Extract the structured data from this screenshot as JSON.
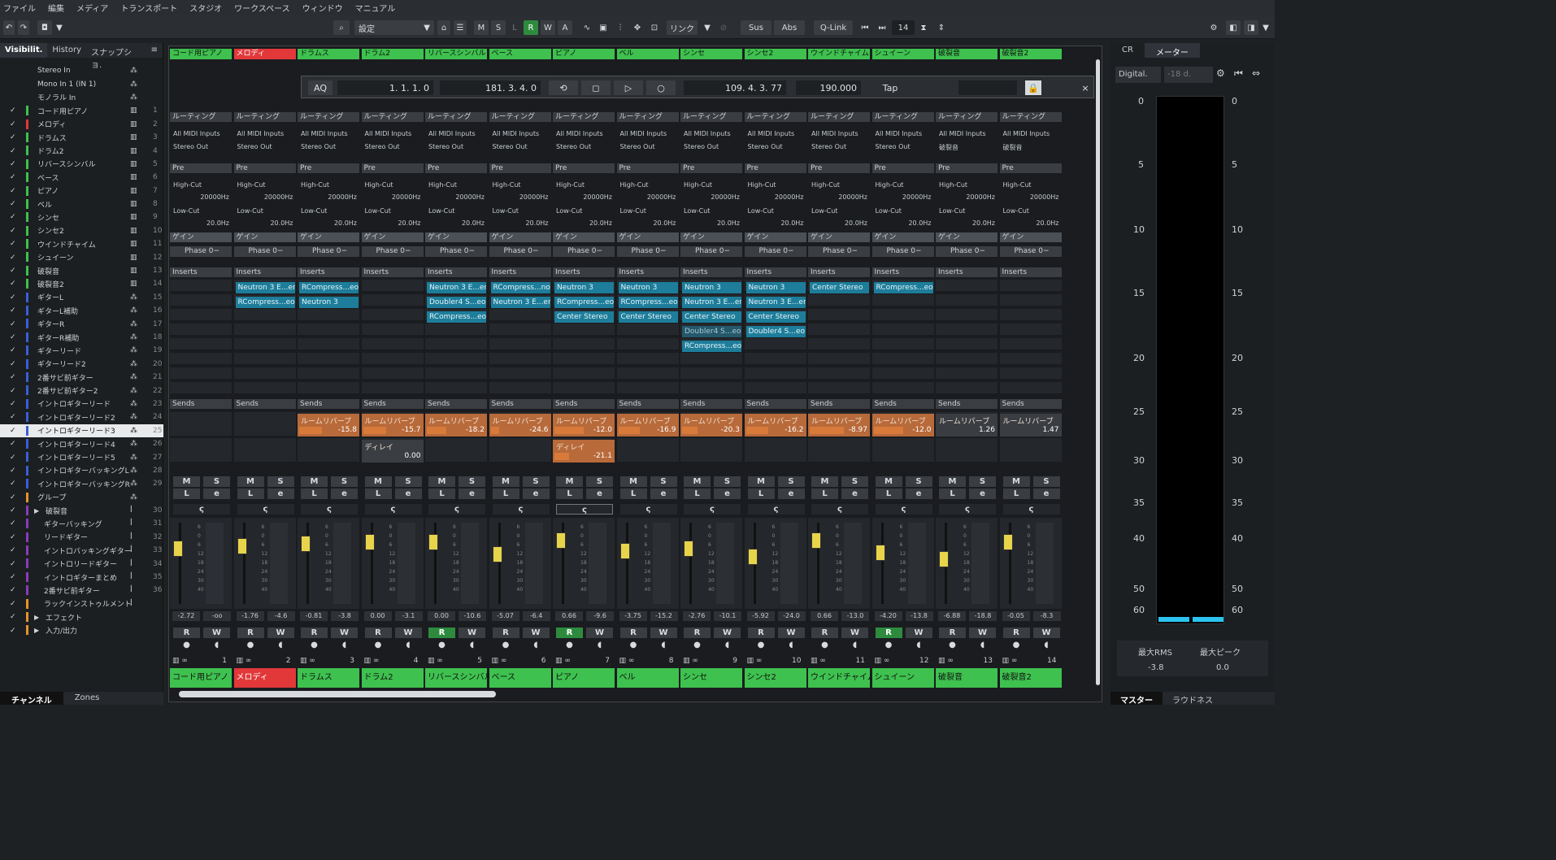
{
  "menu": [
    "ファイル",
    "編集",
    "メディア",
    "トランスポート",
    "スタジオ",
    "ワークスペース",
    "ウィンドウ",
    "マニュアル"
  ],
  "toolbar": {
    "preset": "設定",
    "buttons": [
      "M",
      "S",
      "L",
      "R",
      "W",
      "A"
    ],
    "link": "リンク",
    "sus": "Sus",
    "abs": "Abs",
    "qlink": "Q-Link",
    "count": "14"
  },
  "transport": {
    "aq": "AQ",
    "left_locator": "1. 1. 1.   0",
    "right_locator": "181. 3. 4.   0",
    "position": "109. 4. 3.  77",
    "tempo": "190.000",
    "tap": "Tap"
  },
  "left_panel": {
    "tabs": [
      "Visibilit.",
      "History",
      "スナップショ."
    ],
    "bottom_tabs": [
      "チャンネル",
      "Zones"
    ],
    "rows": [
      {
        "chk": "",
        "color": "",
        "name": "Stereo In",
        "num": ""
      },
      {
        "chk": "",
        "color": "",
        "name": "Mono In 1 (IN 1)",
        "num": ""
      },
      {
        "chk": "",
        "color": "",
        "name": "モノラル In",
        "num": ""
      },
      {
        "chk": "✓",
        "color": "#3ec14f",
        "name": "コード用ピアノ",
        "num": "1"
      },
      {
        "chk": "✓",
        "color": "#e2383a",
        "name": "メロディ",
        "num": "2"
      },
      {
        "chk": "✓",
        "color": "#3ec14f",
        "name": "ドラムス",
        "num": "3"
      },
      {
        "chk": "✓",
        "color": "#3ec14f",
        "name": "ドラム2",
        "num": "4"
      },
      {
        "chk": "✓",
        "color": "#3ec14f",
        "name": "リバースシンバル",
        "num": "5"
      },
      {
        "chk": "✓",
        "color": "#3ec14f",
        "name": "ベース",
        "num": "6"
      },
      {
        "chk": "✓",
        "color": "#3ec14f",
        "name": "ピアノ",
        "num": "7"
      },
      {
        "chk": "✓",
        "color": "#3ec14f",
        "name": "ベル",
        "num": "8"
      },
      {
        "chk": "✓",
        "color": "#3ec14f",
        "name": "シンセ",
        "num": "9"
      },
      {
        "chk": "✓",
        "color": "#3ec14f",
        "name": "シンセ2",
        "num": "10"
      },
      {
        "chk": "✓",
        "color": "#3ec14f",
        "name": "ウインドチャイム",
        "num": "11"
      },
      {
        "chk": "✓",
        "color": "#3ec14f",
        "name": "シュイーン",
        "num": "12"
      },
      {
        "chk": "✓",
        "color": "#3ec14f",
        "name": "破裂音",
        "num": "13"
      },
      {
        "chk": "✓",
        "color": "#3ec14f",
        "name": "破裂音2",
        "num": "14"
      },
      {
        "chk": "✓",
        "color": "#3a5ed8",
        "name": "ギターL",
        "num": "15"
      },
      {
        "chk": "✓",
        "color": "#3a5ed8",
        "name": "ギターL補助",
        "num": "16"
      },
      {
        "chk": "✓",
        "color": "#3a5ed8",
        "name": "ギターR",
        "num": "17"
      },
      {
        "chk": "✓",
        "color": "#3a5ed8",
        "name": "ギターR補助",
        "num": "18"
      },
      {
        "chk": "✓",
        "color": "#3a5ed8",
        "name": "ギターリード",
        "num": "19"
      },
      {
        "chk": "✓",
        "color": "#3a5ed8",
        "name": "ギターリード2",
        "num": "20"
      },
      {
        "chk": "✓",
        "color": "#3a5ed8",
        "name": "2番サビ前ギター",
        "num": "21"
      },
      {
        "chk": "✓",
        "color": "#3a5ed8",
        "name": "2番サビ前ギター2",
        "num": "22"
      },
      {
        "chk": "✓",
        "color": "#3a5ed8",
        "name": "イントロギターリード",
        "num": "23"
      },
      {
        "chk": "✓",
        "color": "#3a5ed8",
        "name": "イントロギターリード2",
        "num": "24"
      },
      {
        "chk": "✓",
        "color": "#3a5ed8",
        "name": "イントロギターリード3",
        "num": "25"
      },
      {
        "chk": "✓",
        "color": "#3a5ed8",
        "name": "イントロギターリード4",
        "num": "26"
      },
      {
        "chk": "✓",
        "color": "#3a5ed8",
        "name": "イントロギターリード5",
        "num": "27"
      },
      {
        "chk": "✓",
        "color": "#3a5ed8",
        "name": "イントロギターバッキングL",
        "num": "28"
      },
      {
        "chk": "✓",
        "color": "#3a5ed8",
        "name": "イントロギターバッキングR",
        "num": "29"
      },
      {
        "chk": "✓",
        "color": "#e8922a",
        "name": "グループ",
        "num": ""
      },
      {
        "chk": "✓",
        "color": "#8a3ab8",
        "name": "破裂音",
        "num": "30"
      },
      {
        "chk": "✓",
        "color": "#8a3ab8",
        "name": "ギターバッキング",
        "num": "31"
      },
      {
        "chk": "✓",
        "color": "#8a3ab8",
        "name": "リードギター",
        "num": "32"
      },
      {
        "chk": "✓",
        "color": "#8a3ab8",
        "name": "イントロバッキングギター",
        "num": "33"
      },
      {
        "chk": "✓",
        "color": "#8a3ab8",
        "name": "イントロリードギター",
        "num": "34"
      },
      {
        "chk": "✓",
        "color": "#8a3ab8",
        "name": "イントロギターまとめ",
        "num": "35"
      },
      {
        "chk": "✓",
        "color": "#8a3ab8",
        "name": "2番サビ前ギター",
        "num": "36"
      },
      {
        "chk": "✓",
        "color": "#e8922a",
        "name": "ラックインストゥルメント",
        "num": ""
      },
      {
        "chk": "✓",
        "color": "#e8922a",
        "name": "エフェクト",
        "num": ""
      },
      {
        "chk": "✓",
        "color": "#e8922a",
        "name": "入力/出力",
        "num": ""
      }
    ]
  },
  "labels": {
    "routing": "ルーティング",
    "all_midi": "All MIDI Inputs",
    "pre": "Pre",
    "high_cut": "High-Cut",
    "high_cut_val": "20000Hz",
    "low_cut": "Low-Cut",
    "low_cut_val": "20.0Hz",
    "gain": "ゲイン",
    "phase": "Phase 0−",
    "inserts": "Inserts",
    "sends": "Sends"
  },
  "channels": [
    {
      "num": "1",
      "name": "コード用ピアノ",
      "color": "red0",
      "out": "Stereo Out",
      "inserts": [],
      "sends": [],
      "fader": "-2.72",
      "peak": "-oo",
      "r_on": false,
      "w_on": false
    },
    {
      "num": "2",
      "name": "メロディ",
      "color": "red",
      "out": "Stereo Out",
      "inserts": [
        "Neutron 3 E...er",
        "RCompress...eo"
      ],
      "sends": [],
      "fader": "-1.76",
      "peak": "-4.6",
      "r_on": false,
      "w_on": false
    },
    {
      "num": "3",
      "name": "ドラムス",
      "color": "green",
      "out": "Stereo Out",
      "inserts": [
        "RCompress...eo",
        "Neutron 3"
      ],
      "sends": [
        {
          "name": "ルームリバーブ",
          "value": "-15.8"
        }
      ],
      "fader": "-0.81",
      "peak": "-3.8",
      "r_on": false,
      "w_on": false
    },
    {
      "num": "4",
      "name": "ドラム2",
      "color": "green",
      "out": "Stereo Out",
      "inserts": [],
      "sends": [
        {
          "name": "ルームリバーブ",
          "value": "-15.7"
        },
        {
          "name": "ディレイ",
          "value": "0.00",
          "grey": true
        }
      ],
      "fader": "0.00",
      "peak": "-3.1",
      "r_on": false,
      "w_on": false
    },
    {
      "num": "5",
      "name": "リバースシンバル",
      "color": "green",
      "out": "Stereo Out",
      "inserts": [
        "Neutron 3 E...er",
        "Doubler4 S...eo",
        "RCompress...eo"
      ],
      "sends": [
        {
          "name": "ルームリバーブ",
          "value": "-18.2"
        }
      ],
      "fader": "0.00",
      "peak": "-10.6",
      "r_on": true,
      "w_on": false
    },
    {
      "num": "6",
      "name": "ベース",
      "color": "green",
      "out": "Stereo Out",
      "inserts": [
        "RCompress...no",
        "Neutron 3 E...er"
      ],
      "sends": [
        {
          "name": "ルームリバーブ",
          "value": "-24.6"
        }
      ],
      "fader": "-5.07",
      "peak": "-6.4",
      "r_on": false,
      "w_on": false
    },
    {
      "num": "7",
      "name": "ピアノ",
      "color": "green",
      "out": "Stereo Out",
      "inserts": [
        "Neutron 3",
        "RCompress...eo",
        "Center Stereo"
      ],
      "sends": [
        {
          "name": "ルームリバーブ",
          "value": "-12.0"
        },
        {
          "name": "ディレイ",
          "value": "-21.1"
        }
      ],
      "fader": "0.66",
      "peak": "-9.6",
      "r_on": true,
      "w_on": false
    },
    {
      "num": "8",
      "name": "ベル",
      "color": "green",
      "out": "Stereo Out",
      "inserts": [
        "Neutron 3",
        "RCompress...eo",
        "Center Stereo"
      ],
      "sends": [
        {
          "name": "ルームリバーブ",
          "value": "-16.9"
        }
      ],
      "fader": "-3.75",
      "peak": "-15.2",
      "r_on": false,
      "w_on": false
    },
    {
      "num": "9",
      "name": "シンセ",
      "color": "green",
      "out": "Stereo Out",
      "inserts": [
        "Neutron 3",
        "Neutron 3 E...er",
        "Center Stereo",
        "Doubler4 S...eo",
        "RCompress...eo"
      ],
      "sends": [
        {
          "name": "ルームリバーブ",
          "value": "-20.3"
        }
      ],
      "fader": "-2.76",
      "peak": "-10.1",
      "r_on": false,
      "w_on": false
    },
    {
      "num": "10",
      "name": "シンセ2",
      "color": "green",
      "out": "Stereo Out",
      "inserts": [
        "Neutron 3",
        "Neutron 3 E...er",
        "Center Stereo",
        "Doubler4 S...eo"
      ],
      "sends": [
        {
          "name": "ルームリバーブ",
          "value": "-16.2"
        }
      ],
      "fader": "-5.92",
      "peak": "-24.0",
      "r_on": false,
      "w_on": false
    },
    {
      "num": "11",
      "name": "ウインドチャイム",
      "color": "green",
      "out": "Stereo Out",
      "inserts": [
        "Center Stereo"
      ],
      "sends": [
        {
          "name": "ルームリバーブ",
          "value": "-8.97"
        }
      ],
      "fader": "0.66",
      "peak": "-13.0",
      "r_on": false,
      "w_on": false
    },
    {
      "num": "12",
      "name": "シュイーン",
      "color": "green",
      "out": "Stereo Out",
      "inserts": [
        "RCompress...eo"
      ],
      "sends": [
        {
          "name": "ルームリバーブ",
          "value": "-12.0"
        }
      ],
      "fader": "-4.20",
      "peak": "-13.8",
      "r_on": true,
      "w_on": false
    },
    {
      "num": "13",
      "name": "破裂音",
      "color": "green",
      "out": "破裂音",
      "inserts": [],
      "sends": [
        {
          "name": "ルームリバーブ",
          "value": "1.26",
          "grey": true
        }
      ],
      "fader": "-6.88",
      "peak": "-18.8",
      "r_on": false,
      "w_on": false
    },
    {
      "num": "14",
      "name": "破裂音2",
      "color": "green",
      "out": "破裂音",
      "inserts": [],
      "sends": [
        {
          "name": "ルームリバーブ",
          "value": "1.47",
          "grey": true
        }
      ],
      "fader": "-0.05",
      "peak": "-8.3",
      "r_on": false,
      "w_on": false
    }
  ],
  "right_panel": {
    "tabs": [
      "CR",
      "メーター"
    ],
    "digital": "Digital.",
    "ref": "-18 d.",
    "scale": [
      "0",
      "5",
      "10",
      "15",
      "20",
      "25",
      "30",
      "35",
      "40",
      "50",
      "60"
    ],
    "max_rms_label": "最大RMS",
    "max_peak_label": "最大ピーク",
    "max_rms": "-3.8",
    "max_peak": "0.0",
    "bottom_tabs": [
      "マスター",
      "ラウドネス"
    ]
  }
}
